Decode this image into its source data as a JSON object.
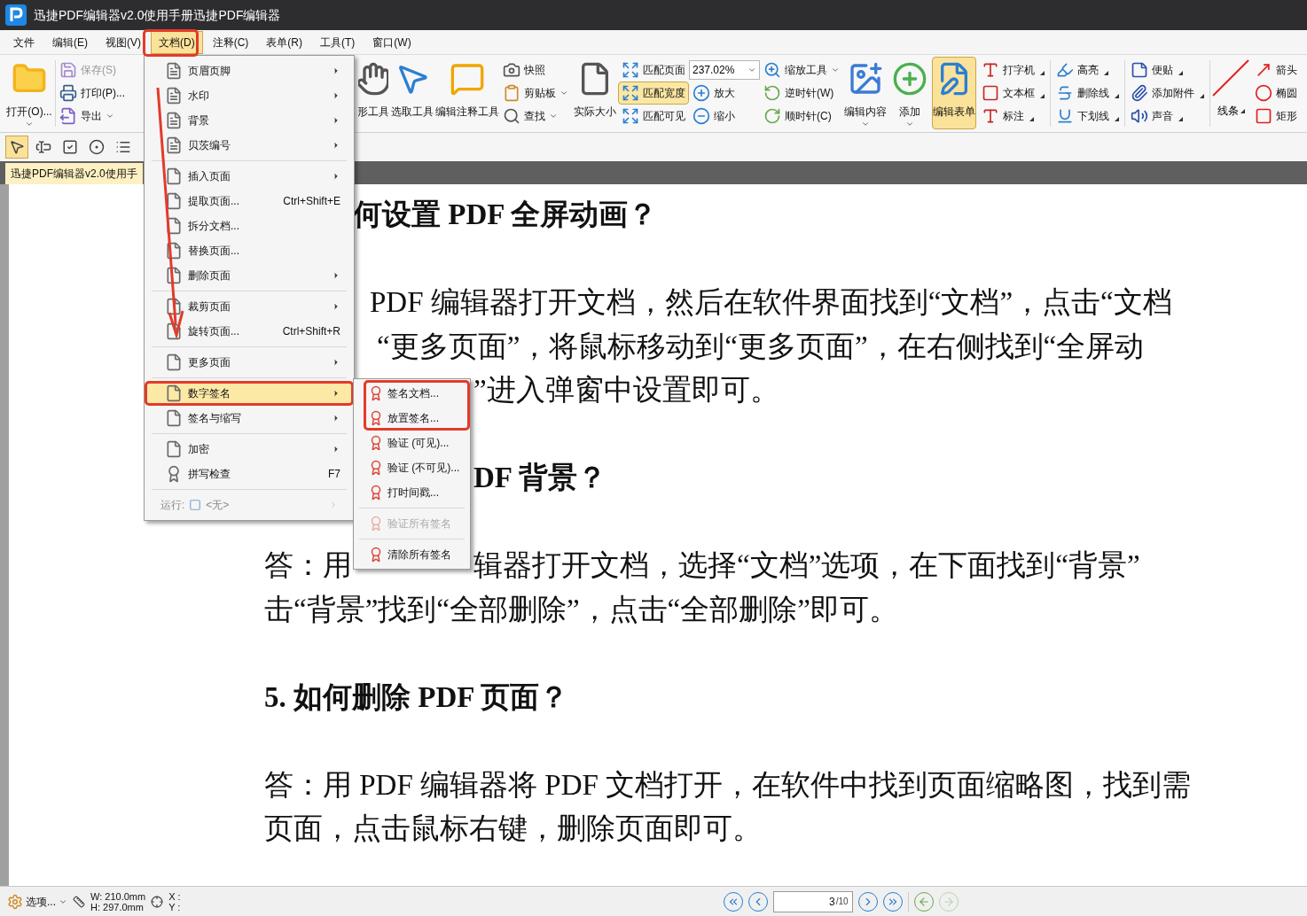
{
  "window": {
    "title": "迅捷PDF编辑器v2.0使用手册迅捷PDF编辑器"
  },
  "menubar": [
    {
      "label": "文件",
      "selected": false
    },
    {
      "label": "编辑(E)",
      "selected": false
    },
    {
      "label": "视图(V)",
      "selected": false
    },
    {
      "label": "文档(D)",
      "selected": true
    },
    {
      "label": "注释(C)",
      "selected": false
    },
    {
      "label": "表单(R)",
      "selected": false
    },
    {
      "label": "工具(T)",
      "selected": false
    },
    {
      "label": "窗口(W)",
      "selected": false
    }
  ],
  "ribbon": {
    "open": "打开(O)...",
    "save": {
      "label": "保存(S)",
      "disabled": true
    },
    "print": "打印(P)...",
    "export": "导出",
    "tools": [
      "形工具",
      "选取工具",
      "编辑注释工具"
    ],
    "clipboard": [
      "快照",
      "剪贴板",
      "查找"
    ],
    "actual_size": "实际大小",
    "fit": [
      {
        "label": "匹配页面",
        "selected": false
      },
      {
        "label": "匹配宽度",
        "selected": true
      },
      {
        "label": "匹配可见",
        "selected": false
      }
    ],
    "zoom_value": "237.02%",
    "zoom_tool": "缩放工具",
    "zoom_in": "放大",
    "zoom_out": "缩小",
    "rotate": [
      "逆时针(W)",
      "顺时针(C)"
    ],
    "edit": [
      {
        "label": "编辑内容",
        "selected": false
      },
      {
        "label": "添加",
        "selected": false
      },
      {
        "label": "编辑表单",
        "selected": true
      }
    ],
    "annotations": [
      [
        "打字机",
        "文本框",
        "标注"
      ],
      [
        "高亮",
        "删除线",
        "下划线"
      ],
      [
        "便贴",
        "添加附件",
        "声音"
      ]
    ],
    "line": "线条",
    "shapes": [
      "箭头",
      "椭圆",
      "矩形"
    ]
  },
  "form_tools": [
    {
      "selected": true
    },
    {
      "selected": false
    },
    {
      "selected": false
    },
    {
      "selected": false
    },
    {
      "selected": false
    }
  ],
  "tab": {
    "label": "迅捷PDF编辑器v2.0使用手",
    "selected": true
  },
  "document": {
    "blocks": [
      {
        "kind": "heading",
        "lines": [
          [
            "何设置 PDF 全屏动画？"
          ]
        ]
      },
      {
        "kind": "paragraph",
        "lines": [
          [
            "PDF 编辑器打开文档，然后在软件界面找到“文档”，点击“文档"
          ],
          [
            "“更多页面”，将鼠标移动到“更多页面”，在右侧找到“全屏动"
          ],
          [
            "”进入弹窗中设置即可。"
          ]
        ]
      },
      {
        "kind": "heading",
        "lines": [
          [
            "DF 背景？"
          ]
        ]
      },
      {
        "kind": "paragraph",
        "lines": [
          [
            "答：用",
            "辑器打开文档，选择“文档”选项，在下面找到“背景”"
          ],
          [
            "击“背景”找到“全部删除”，点击“全部删除”即可。"
          ]
        ]
      },
      {
        "kind": "heading",
        "lines": [
          [
            "5.  如何删除 PDF 页面？"
          ]
        ]
      },
      {
        "kind": "paragraph",
        "lines": [
          [
            "答：用 PDF 编辑器将 PDF 文档打开，在软件中找到页面缩略图，找到需"
          ],
          [
            "页面，点击鼠标右键，删除页面即可。"
          ]
        ]
      }
    ]
  },
  "menu": {
    "items": [
      {
        "kind": "item",
        "label": "页眉页脚",
        "submenu": true,
        "selected": false
      },
      {
        "kind": "item",
        "label": "水印",
        "submenu": true,
        "selected": false
      },
      {
        "kind": "item",
        "label": "背景",
        "submenu": true,
        "selected": false
      },
      {
        "kind": "item",
        "label": "贝茨编号",
        "submenu": true,
        "selected": false
      },
      {
        "kind": "separator"
      },
      {
        "kind": "item",
        "label": "插入页面",
        "submenu": true,
        "selected": false
      },
      {
        "kind": "item",
        "label": "提取页面...",
        "shortcut": "Ctrl+Shift+E",
        "submenu": false,
        "selected": false
      },
      {
        "kind": "item",
        "label": "拆分文档...",
        "submenu": false,
        "selected": false
      },
      {
        "kind": "item",
        "label": "替换页面...",
        "submenu": false,
        "selected": false
      },
      {
        "kind": "item",
        "label": "删除页面",
        "submenu": true,
        "selected": false
      },
      {
        "kind": "separator"
      },
      {
        "kind": "item",
        "label": "裁剪页面",
        "submenu": true,
        "selected": false
      },
      {
        "kind": "item",
        "label": "旋转页面...",
        "shortcut": "Ctrl+Shift+R",
        "submenu": false,
        "selected": false
      },
      {
        "kind": "separator"
      },
      {
        "kind": "item",
        "label": "更多页面",
        "submenu": true,
        "selected": false
      },
      {
        "kind": "separator"
      },
      {
        "kind": "item",
        "label": "数字签名",
        "submenu": true,
        "selected": true
      },
      {
        "kind": "item",
        "label": "签名与缩写",
        "submenu": true,
        "selected": false
      },
      {
        "kind": "separator"
      },
      {
        "kind": "item",
        "label": "加密",
        "submenu": true,
        "selected": false
      },
      {
        "kind": "item",
        "label": "拼写检查",
        "shortcut": "F7",
        "submenu": false,
        "selected": false
      },
      {
        "kind": "separator"
      },
      {
        "kind": "run",
        "label": "运行:",
        "value": "<无>",
        "submenu": true
      }
    ]
  },
  "submenu": {
    "items": [
      {
        "kind": "item",
        "label": "签名文档...",
        "disabled": false
      },
      {
        "kind": "item",
        "label": "放置签名...",
        "disabled": false
      },
      {
        "kind": "item",
        "label": "验证 (可见)...",
        "disabled": false
      },
      {
        "kind": "item",
        "label": "验证 (不可见)...",
        "disabled": false
      },
      {
        "kind": "item",
        "label": "打时间戳...",
        "disabled": false
      },
      {
        "kind": "separator"
      },
      {
        "kind": "item",
        "label": "验证所有签名",
        "disabled": true
      },
      {
        "kind": "separator"
      },
      {
        "kind": "item",
        "label": "清除所有签名",
        "disabled": false
      }
    ]
  },
  "status_bar": {
    "options": "选项...",
    "width": "W: 210.0mm",
    "height": "H: 297.0mm",
    "x": "X :",
    "y": "Y :",
    "page": "3",
    "total": "/10"
  }
}
